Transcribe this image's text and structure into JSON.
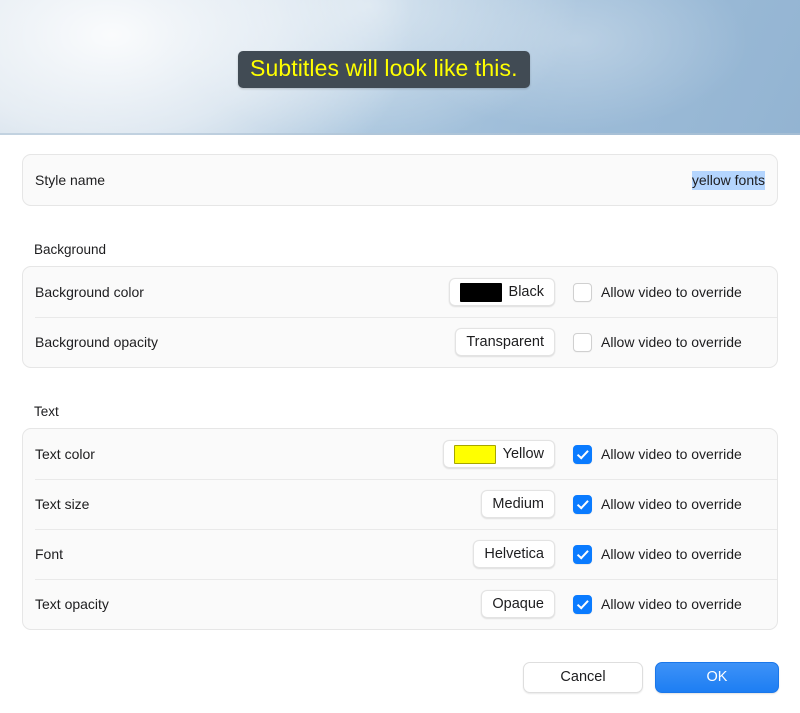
{
  "preview": {
    "subtitle_text": "Subtitles will look like this.",
    "subtitle_text_color": "#ffff00",
    "subtitle_box_color": "#414b54"
  },
  "style_name_row": {
    "label": "Style name",
    "value": "yellow fonts",
    "selection_color": "#b4d5fe"
  },
  "background_section": {
    "title": "Background",
    "rows": [
      {
        "label": "Background color",
        "value": "Black",
        "swatch": "#000000",
        "has_swatch": true,
        "override_label": "Allow video to override",
        "override_checked": false
      },
      {
        "label": "Background opacity",
        "value": "Transparent",
        "has_swatch": false,
        "override_label": "Allow video to override",
        "override_checked": false
      }
    ]
  },
  "text_section": {
    "title": "Text",
    "rows": [
      {
        "label": "Text color",
        "value": "Yellow",
        "swatch": "#ffff00",
        "has_swatch": true,
        "override_label": "Allow video to override",
        "override_checked": true
      },
      {
        "label": "Text size",
        "value": "Medium",
        "has_swatch": false,
        "override_label": "Allow video to override",
        "override_checked": true
      },
      {
        "label": "Font",
        "value": "Helvetica",
        "has_swatch": false,
        "override_label": "Allow video to override",
        "override_checked": true
      },
      {
        "label": "Text opacity",
        "value": "Opaque",
        "has_swatch": false,
        "override_label": "Allow video to override",
        "override_checked": true
      }
    ]
  },
  "footer": {
    "cancel_label": "Cancel",
    "ok_label": "OK",
    "ok_accent_color": "#2b87f5"
  }
}
